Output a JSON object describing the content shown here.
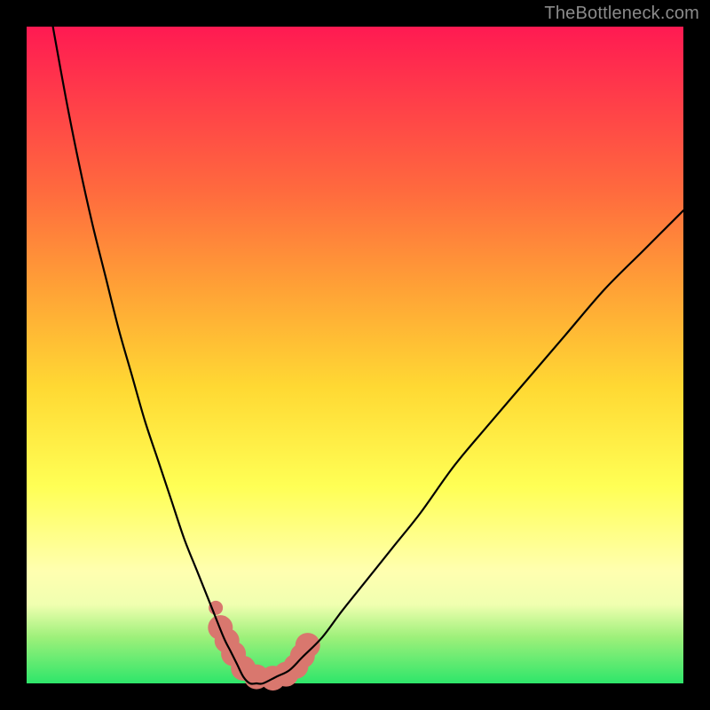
{
  "watermark": {
    "text": "TheBottleneck.com"
  },
  "chart_data": {
    "type": "line",
    "title": "",
    "xlabel": "",
    "ylabel": "",
    "xlim": [
      0,
      100
    ],
    "ylim": [
      0,
      100
    ],
    "series": [
      {
        "name": "bottleneck-curve",
        "x": [
          4,
          6,
          8,
          10,
          12,
          14,
          16,
          18,
          20,
          22,
          24,
          26,
          28,
          30,
          31,
          32,
          33,
          34,
          35,
          36,
          38,
          40,
          42,
          45,
          48,
          52,
          56,
          60,
          65,
          70,
          76,
          82,
          88,
          94,
          100
        ],
        "values": [
          100,
          89,
          79,
          70,
          62,
          54,
          47,
          40,
          34,
          28,
          22,
          17,
          12,
          7,
          5,
          3,
          1,
          0,
          0,
          0,
          1,
          2,
          4,
          7,
          11,
          16,
          21,
          26,
          33,
          39,
          46,
          53,
          60,
          66,
          72
        ]
      }
    ],
    "annotations": [
      {
        "name": "highlight-band",
        "type": "marker-run",
        "x": [
          29.5,
          30.5,
          31.5,
          33.0,
          35.0,
          37.5,
          39.5,
          41.0,
          42.0,
          42.8
        ],
        "values": [
          8.5,
          6.5,
          4.5,
          2.3,
          1.0,
          0.8,
          1.4,
          2.6,
          4.2,
          5.8
        ],
        "color": "#d9776e",
        "radius_px": 14
      },
      {
        "name": "highlight-dot",
        "type": "marker",
        "x": 28.8,
        "value": 11.5,
        "color": "#d9776e",
        "radius_px": 8
      }
    ]
  }
}
